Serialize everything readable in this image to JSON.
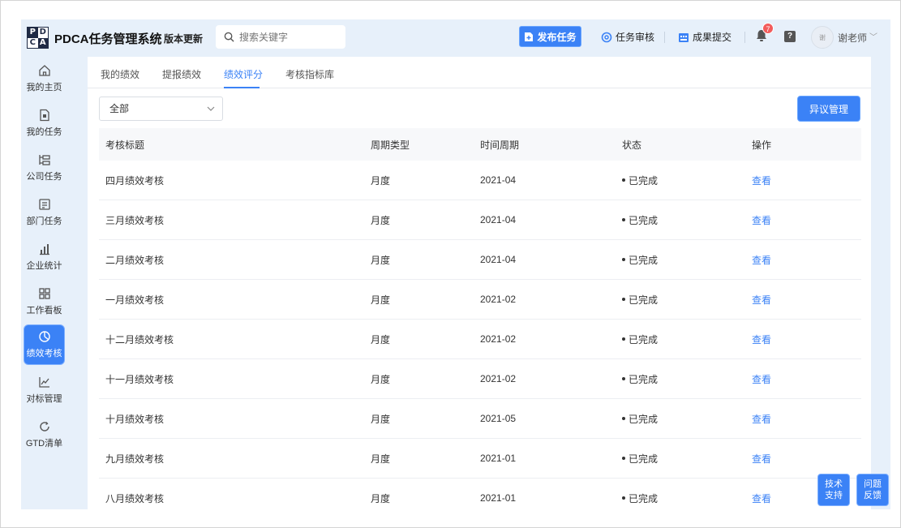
{
  "header": {
    "logo_letters": [
      "P",
      "D",
      "C",
      "A"
    ],
    "app_title": "PDCA任务管理系统",
    "version_label": "版本更新",
    "search_placeholder": "搜索关键字",
    "publish_label": "发布任务",
    "review_label": "任务审核",
    "submit_label": "成果提交",
    "notification_count": "7",
    "help_label": "?",
    "avatar_text": "谢",
    "user_name": "谢老师",
    "user_caret": "﹀"
  },
  "sidebar": {
    "items": [
      {
        "label": "我的主页",
        "icon": "home-icon"
      },
      {
        "label": "我的任务",
        "icon": "file-icon"
      },
      {
        "label": "公司任务",
        "icon": "tree-icon"
      },
      {
        "label": "部门任务",
        "icon": "calendar-icon"
      },
      {
        "label": "企业统计",
        "icon": "bar-chart-icon"
      },
      {
        "label": "工作看板",
        "icon": "grid-icon"
      },
      {
        "label": "绩效考核",
        "icon": "target-icon",
        "active": true
      },
      {
        "label": "对标管理",
        "icon": "line-chart-icon"
      },
      {
        "label": "GTD清单",
        "icon": "refresh-icon"
      }
    ]
  },
  "tabs": [
    {
      "label": "我的绩效"
    },
    {
      "label": "提报绩效"
    },
    {
      "label": "绩效评分",
      "active": true
    },
    {
      "label": "考核指标库"
    }
  ],
  "filter": {
    "value": "全部"
  },
  "dispute_button": "异议管理",
  "table": {
    "headers": [
      "考核标题",
      "周期类型",
      "时间周期",
      "状态",
      "操作"
    ],
    "rows": [
      {
        "title": "四月绩效考核",
        "cycle": "月度",
        "period": "2021-04",
        "status": "已完成",
        "action": "查看"
      },
      {
        "title": "三月绩效考核",
        "cycle": "月度",
        "period": "2021-04",
        "status": "已完成",
        "action": "查看"
      },
      {
        "title": "二月绩效考核",
        "cycle": "月度",
        "period": "2021-04",
        "status": "已完成",
        "action": "查看"
      },
      {
        "title": "一月绩效考核",
        "cycle": "月度",
        "period": "2021-02",
        "status": "已完成",
        "action": "查看"
      },
      {
        "title": "十二月绩效考核",
        "cycle": "月度",
        "period": "2021-02",
        "status": "已完成",
        "action": "查看"
      },
      {
        "title": "十一月绩效考核",
        "cycle": "月度",
        "period": "2021-02",
        "status": "已完成",
        "action": "查看"
      },
      {
        "title": "十月绩效考核",
        "cycle": "月度",
        "period": "2021-05",
        "status": "已完成",
        "action": "查看"
      },
      {
        "title": "九月绩效考核",
        "cycle": "月度",
        "period": "2021-01",
        "status": "已完成",
        "action": "查看"
      },
      {
        "title": "八月绩效考核",
        "cycle": "月度",
        "period": "2021-01",
        "status": "已完成",
        "action": "查看"
      }
    ]
  },
  "floating": {
    "tech_support": "技术\n支持",
    "feedback": "问题\n反馈"
  },
  "colors": {
    "accent": "#3b82f6",
    "app_background": "#e7f0fa",
    "badge": "#f25c5c"
  }
}
